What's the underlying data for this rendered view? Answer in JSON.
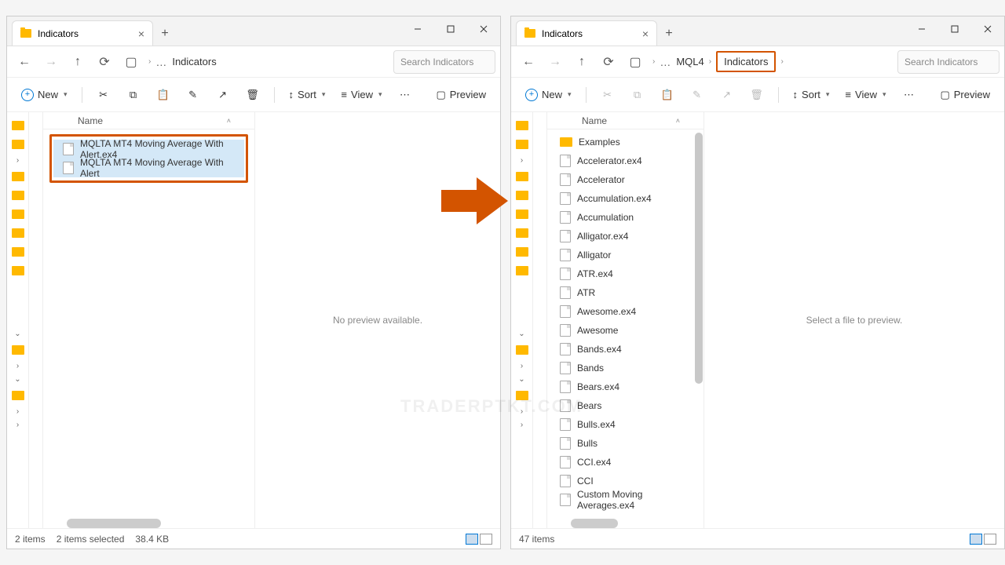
{
  "left": {
    "tab_title": "Indicators",
    "breadcrumb_current": "Indicators",
    "search_placeholder": "Search Indicators",
    "toolbar": {
      "new": "New",
      "sort": "Sort",
      "view": "View",
      "preview": "Preview"
    },
    "col_name": "Name",
    "files": [
      "MQLTA MT4 Moving Average With Alert.ex4",
      "MQLTA MT4 Moving Average With Alert"
    ],
    "preview_text": "No preview available.",
    "status_items": "2 items",
    "status_selected": "2 items selected",
    "status_size": "38.4 KB"
  },
  "right": {
    "tab_title": "Indicators",
    "breadcrumb_parent": "MQL4",
    "breadcrumb_current": "Indicators",
    "search_placeholder": "Search Indicators",
    "toolbar": {
      "new": "New",
      "sort": "Sort",
      "view": "View",
      "preview": "Preview"
    },
    "col_name": "Name",
    "folder": "Examples",
    "files": [
      "Accelerator.ex4",
      "Accelerator",
      "Accumulation.ex4",
      "Accumulation",
      "Alligator.ex4",
      "Alligator",
      "ATR.ex4",
      "ATR",
      "Awesome.ex4",
      "Awesome",
      "Bands.ex4",
      "Bands",
      "Bears.ex4",
      "Bears",
      "Bulls.ex4",
      "Bulls",
      "CCI.ex4",
      "CCI",
      "Custom Moving Averages.ex4"
    ],
    "preview_text": "Select a file to preview.",
    "status_items": "47 items"
  },
  "watermark": "TRADERPTKT.COM"
}
